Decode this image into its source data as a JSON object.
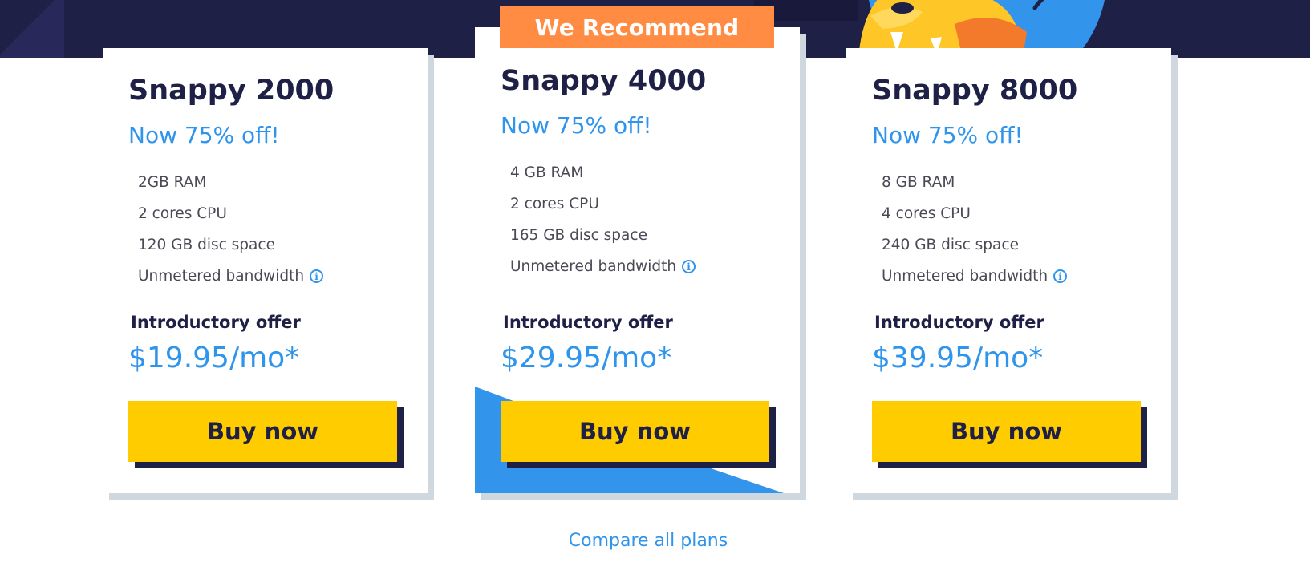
{
  "badge": {
    "label": "We Recommend"
  },
  "plans": [
    {
      "title": "Snappy 2000",
      "discount": "Now 75% off!",
      "features": [
        "2GB RAM",
        "2 cores CPU",
        "120 GB disc space",
        "Unmetered bandwidth"
      ],
      "offer_label": "Introductory offer",
      "price": "$19.95/mo*",
      "button_label": "Buy now"
    },
    {
      "title": "Snappy 4000",
      "discount": "Now 75% off!",
      "features": [
        "4 GB RAM",
        "2 cores CPU",
        "165 GB disc space",
        "Unmetered bandwidth"
      ],
      "offer_label": "Introductory offer",
      "price": "$29.95/mo*",
      "button_label": "Buy now",
      "recommended": true
    },
    {
      "title": "Snappy 8000",
      "discount": "Now 75% off!",
      "features": [
        "8 GB RAM",
        "4 cores CPU",
        "240 GB disc space",
        "Unmetered bandwidth"
      ],
      "offer_label": "Introductory offer",
      "price": "$39.95/mo*",
      "button_label": "Buy now"
    }
  ],
  "compare_link": "Compare all plans",
  "colors": {
    "navy": "#1f2046",
    "accent_blue": "#2f94ec",
    "badge_orange": "#ff8c42",
    "button_yellow": "#ffcc00",
    "shadow_gray": "#cfd8df"
  },
  "icons": {
    "info": "info-circle-icon",
    "mascot": "snake-mascot-illustration"
  }
}
